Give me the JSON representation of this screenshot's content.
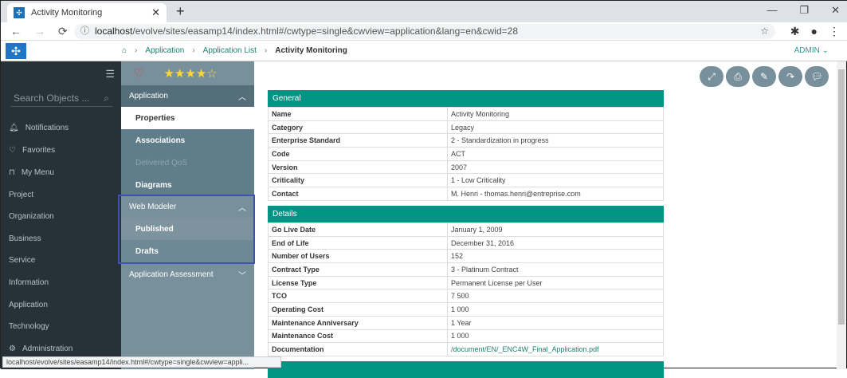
{
  "browser": {
    "tab_title": "Activity Monitoring",
    "url_host": "localhost",
    "url_path": "/evolve/sites/easamp14/index.html#/cwtype=single&cwview=application&lang=en&cwid=28",
    "status_url": "localhost/evolve/sites/easamp14/index.html#/cwtype=single&cwview=appli..."
  },
  "header": {
    "breadcrumb": [
      "Application",
      "Application List",
      "Activity Monitoring"
    ],
    "user": "ADMIN"
  },
  "sidebar": {
    "search_placeholder": "Search Objects ...",
    "items": [
      "Notifications",
      "Favorites",
      "My Menu",
      "Project",
      "Organization",
      "Business",
      "Service",
      "Information",
      "Application",
      "Technology",
      "Administration"
    ]
  },
  "panel": {
    "rating": 4,
    "groups": [
      {
        "label": "Application",
        "items": [
          "Properties",
          "Associations",
          "Delivered QoS",
          "Diagrams"
        ]
      },
      {
        "label": "Web Modeler",
        "items": [
          "Published",
          "Drafts"
        ]
      },
      {
        "label": "Application Assessment"
      }
    ]
  },
  "general": {
    "title": "General",
    "rows": [
      [
        "Name",
        "Activity Monitoring"
      ],
      [
        "Category",
        "Legacy"
      ],
      [
        "Enterprise Standard",
        "2 - Standardization in progress"
      ],
      [
        "Code",
        "ACT"
      ],
      [
        "Version",
        "2007"
      ],
      [
        "Criticality",
        "1 - Low Criticality"
      ],
      [
        "Contact",
        "M. Henri - thomas.henri@entreprise.com"
      ]
    ]
  },
  "details": {
    "title": "Details",
    "rows": [
      [
        "Go Live Date",
        "January 1, 2009"
      ],
      [
        "End of Life",
        "December 31, 2016"
      ],
      [
        "Number of Users",
        "152"
      ],
      [
        "Contract Type",
        "3 - Platinum Contract"
      ],
      [
        "License Type",
        "Permanent License per User"
      ],
      [
        "TCO",
        "7 500"
      ],
      [
        "Operating Cost",
        "1 000"
      ],
      [
        "Maintenance Anniversary",
        "1 Year"
      ],
      [
        "Maintenance Cost",
        "1 000"
      ],
      [
        "Documentation",
        "/document/EN/_ENC4W_Final_Application.pdf"
      ]
    ]
  }
}
